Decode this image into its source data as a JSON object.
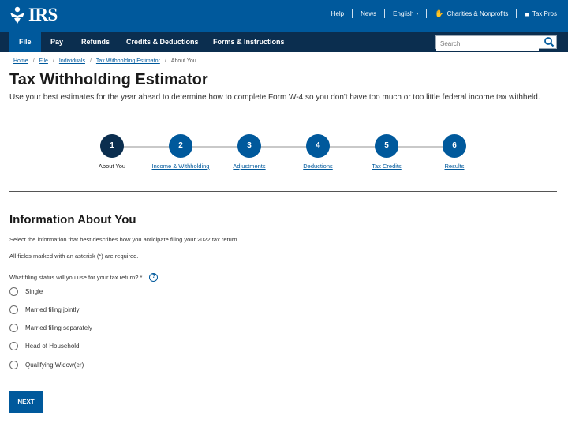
{
  "header": {
    "logo_text": "IRS",
    "utility_links": [
      {
        "label": "Help",
        "icon": ""
      },
      {
        "label": "News",
        "icon": ""
      },
      {
        "label": "English",
        "icon": "chevron-down-icon"
      },
      {
        "label": "Charities & Nonprofits",
        "icon": "handshake-icon"
      },
      {
        "label": "Tax Pros",
        "icon": "briefcase-icon"
      }
    ]
  },
  "nav": {
    "items": [
      "File",
      "Pay",
      "Refunds",
      "Credits & Deductions",
      "Forms & Instructions"
    ],
    "search_placeholder": "Search"
  },
  "breadcrumb": [
    "Home",
    "File",
    "Individuals",
    "Tax Withholding Estimator",
    "About You"
  ],
  "page": {
    "title": "Tax Withholding Estimator",
    "intro": "Use your best estimates for the year ahead to determine how to complete Form W-4 so you don't have too much or too little federal income tax withheld."
  },
  "stepper": {
    "current_step": 1,
    "steps": [
      {
        "number": "1",
        "label": "About You"
      },
      {
        "number": "2",
        "label": "Income & Withholding"
      },
      {
        "number": "3",
        "label": "Adjustments"
      },
      {
        "number": "4",
        "label": "Deductions"
      },
      {
        "number": "5",
        "label": "Tax Credits"
      },
      {
        "number": "6",
        "label": "Results"
      }
    ]
  },
  "form": {
    "section_title": "Information About You",
    "instructions": "Select the information that best describes how you anticipate filing your 2022 tax return.",
    "required_note": "All fields marked with an asterisk (*) are required.",
    "question": "What filing status will you use for your tax return? *",
    "options": [
      "Single",
      "Married filing jointly",
      "Married filing separately",
      "Head of Household",
      "Qualifying Widow(er)"
    ],
    "next_label": "NEXT"
  },
  "colors": {
    "brand_blue": "#00599c",
    "navy": "#0b2e4f"
  }
}
